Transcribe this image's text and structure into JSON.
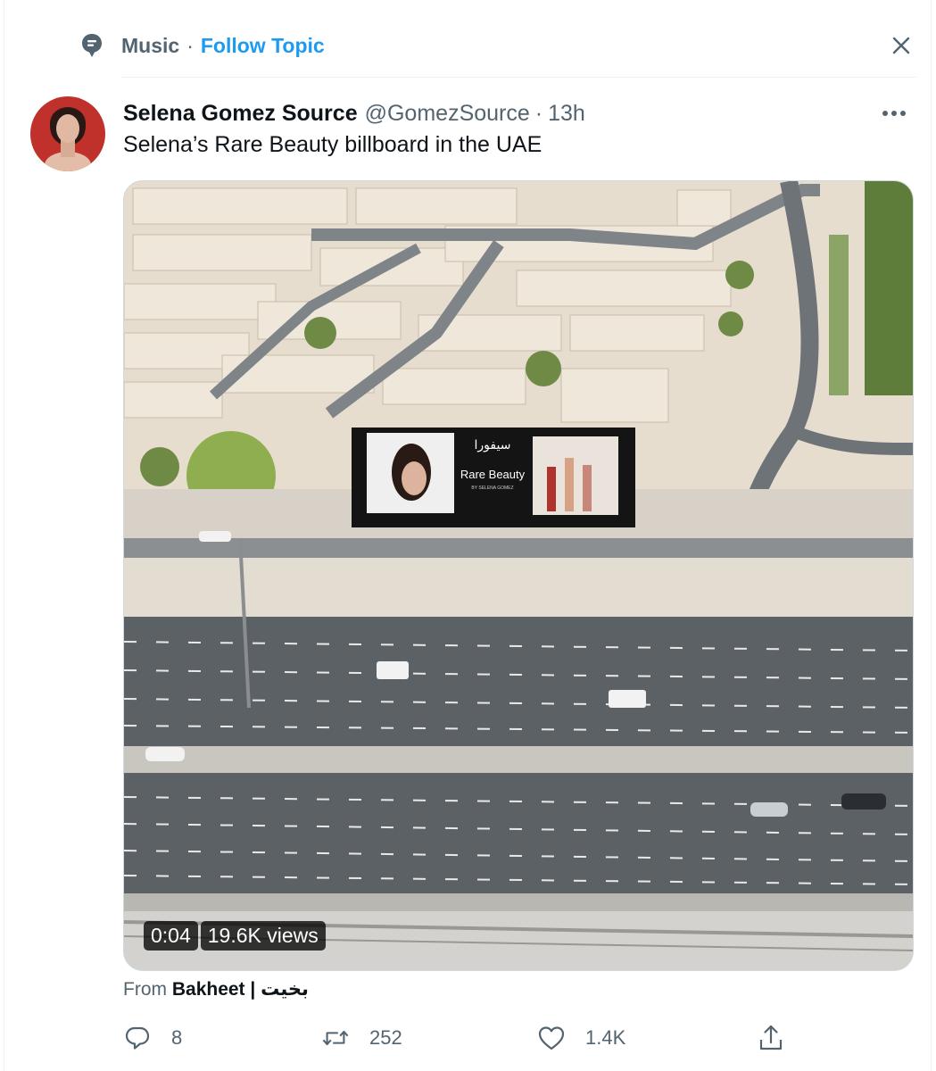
{
  "topic": {
    "name": "Music",
    "separator": "·",
    "follow_label": "Follow Topic",
    "icon": "topic-bubble-icon",
    "close_icon": "close-icon"
  },
  "tweet": {
    "author_name": "Selena Gomez Source",
    "handle": "@GomezSource",
    "separator": "·",
    "time": "13h",
    "text": "Selena’s Rare Beauty billboard in the UAE",
    "more_icon": "more-icon"
  },
  "media": {
    "duration": "0:04",
    "views": "19.6K views",
    "billboard_brand": "Rare Beauty",
    "billboard_sub": "BY SELENA GOMEZ",
    "billboard_arabic": "سيفورا"
  },
  "source": {
    "prefix": "From",
    "name": "Bakheet | بخيت"
  },
  "actions": {
    "reply_count": "8",
    "retweet_count": "252",
    "like_count": "1.4K",
    "icons": [
      "reply-icon",
      "retweet-icon",
      "like-icon",
      "share-icon"
    ]
  },
  "colors": {
    "accent": "#1d9bf0",
    "secondary_text": "#536471",
    "primary_text": "#0f1419"
  }
}
